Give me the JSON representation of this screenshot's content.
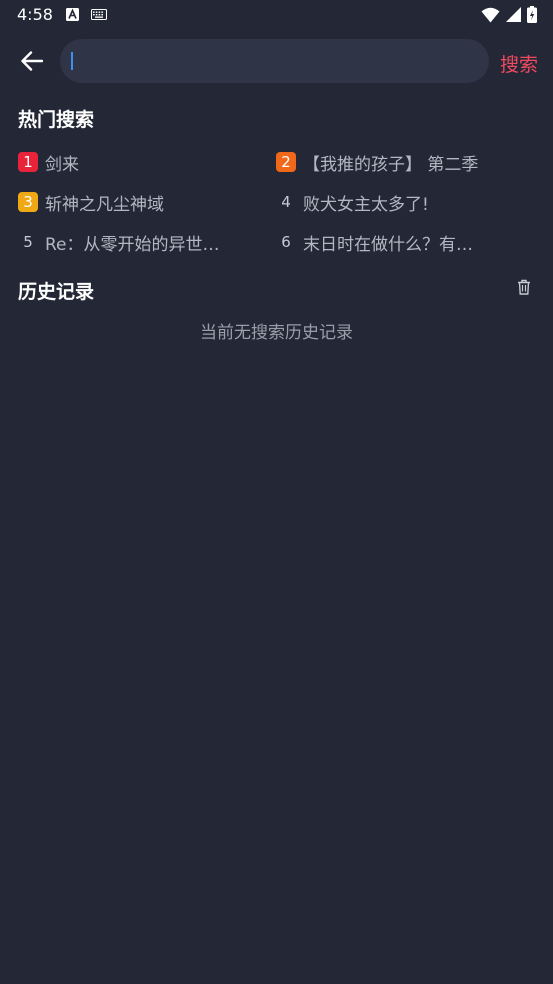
{
  "status": {
    "time": "4:58"
  },
  "search": {
    "placeholder": "",
    "value": "",
    "action_label": "搜索"
  },
  "hot": {
    "title": "热门搜索",
    "items": [
      {
        "rank": "1",
        "text": "剑来",
        "color": "#e8233a"
      },
      {
        "rank": "2",
        "text": "【我推的孩子】 第二季",
        "color": "#f2681b"
      },
      {
        "rank": "3",
        "text": "斩神之凡尘神域",
        "color": "#f0a914"
      },
      {
        "rank": "4",
        "text": "败犬女主太多了!",
        "color": ""
      },
      {
        "rank": "5",
        "text": "Re：从零开始的异世…",
        "color": ""
      },
      {
        "rank": "6",
        "text": "末日时在做什么？有…",
        "color": ""
      }
    ]
  },
  "history": {
    "title": "历史记录",
    "empty": "当前无搜索历史记录"
  },
  "colors": {
    "background": "#242836",
    "accent": "#ef4a5f",
    "search_bg": "#2f3446"
  }
}
